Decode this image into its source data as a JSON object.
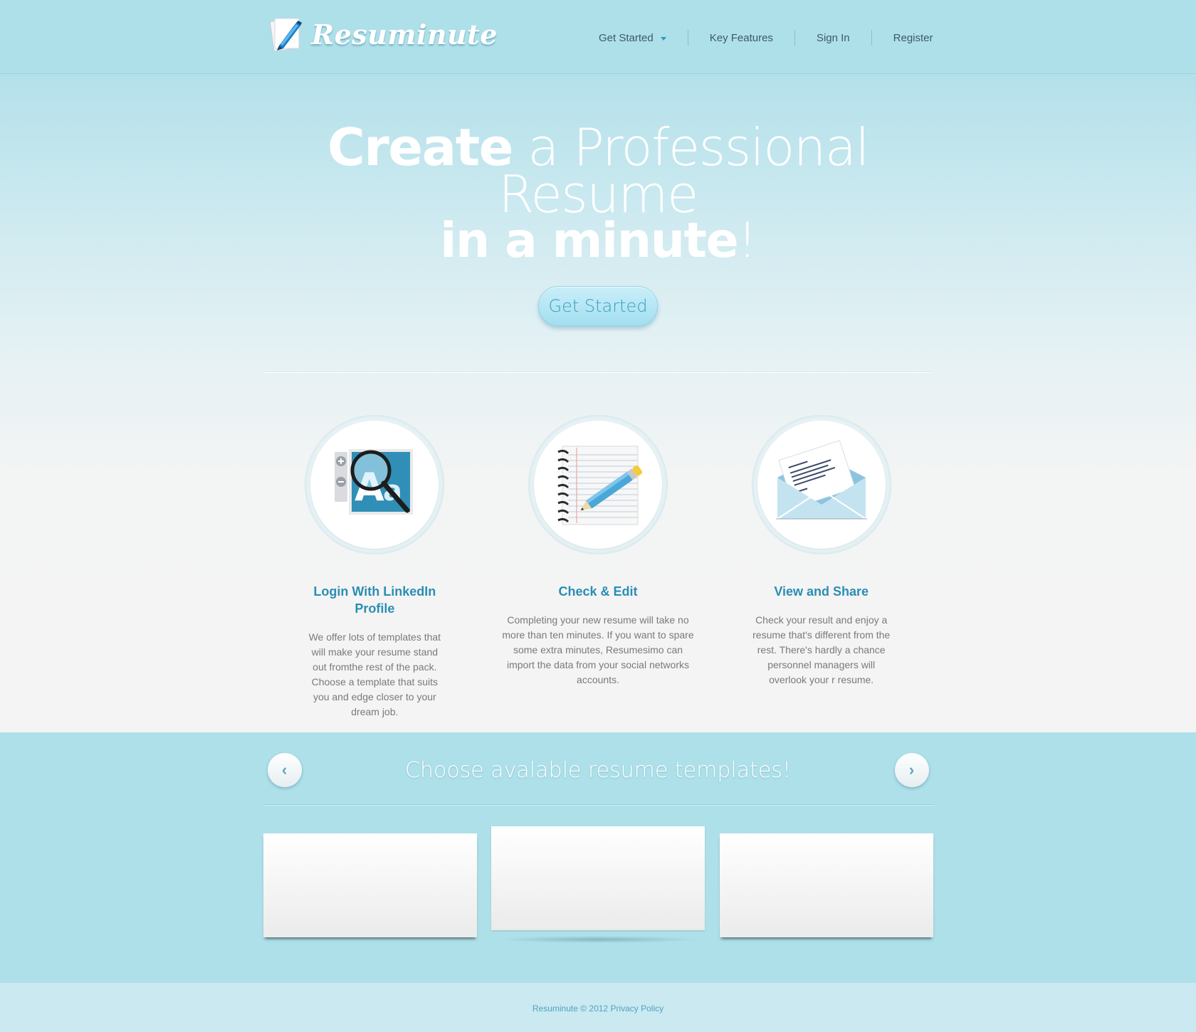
{
  "brand": {
    "name": "Resuminute",
    "logo_icon": "pen-icon"
  },
  "nav": {
    "items": [
      {
        "label": "Get Started",
        "has_dropdown": true
      },
      {
        "label": "Key Features"
      },
      {
        "label": "Sign In"
      },
      {
        "label": "Register"
      }
    ]
  },
  "hero": {
    "line1_bold": "Create",
    "line1_rest": " a Professional Resume",
    "line2_bold": "in a minute",
    "line2_rest": "!",
    "cta_label": "Get Started"
  },
  "features": [
    {
      "icon": "magnifier-font-icon",
      "title": "Login With LinkedIn Profile",
      "text": "We offer lots of templates that will make your resume stand out fromthe rest of the pack. Choose a template that suits you and edge closer to your dream job."
    },
    {
      "icon": "notebook-pencil-icon",
      "title": "Check & Edit",
      "text": "Completing your new resume will take no more than ten minutes. If you want to spare some extra minutes, Resumesimo can import the data from your social networks accounts."
    },
    {
      "icon": "envelope-letter-icon",
      "title": "View and Share",
      "text": "Check your result and enjoy a resume that's different from the rest. There's hardly a chance personnel managers will overlook your r resume."
    }
  ],
  "templates": {
    "title": "Choose avalable resume templates!",
    "prev_icon": "chevron-left-icon",
    "next_icon": "chevron-right-icon"
  },
  "footer": {
    "brand": "Resuminute",
    "copyright": " © 2012 ",
    "privacy": "Privacy Policy"
  },
  "colors": {
    "header_bg": "#aee0ea",
    "accent": "#2a8eb4",
    "footer_bg": "#cae9f0"
  }
}
